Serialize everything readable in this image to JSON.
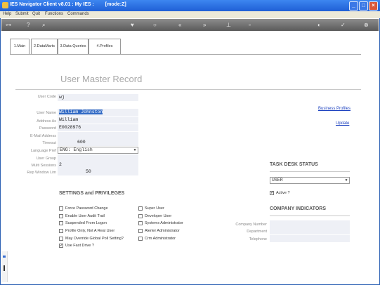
{
  "window": {
    "title": "IES Navigator Client v8.01 : My IES :",
    "mode": "[mode:Z]"
  },
  "menu": [
    "Help",
    "Submit",
    "Quit",
    "Functions",
    "Commands"
  ],
  "tabs": [
    "1.Main",
    "2.DataMarts",
    "3.Data Queries",
    "4.Profiles"
  ],
  "page_title": "User Master Record",
  "form": {
    "user_code": {
      "label": "User Code",
      "value": "wj"
    },
    "user_name": {
      "label": "User Name",
      "value": "William Johnston"
    },
    "address_as": {
      "label": "Address As",
      "value": "William"
    },
    "password": {
      "label": "Password",
      "value": "E0028976"
    },
    "email": {
      "label": "E-Mail Address",
      "value": ""
    },
    "timeout": {
      "label": "Timeout",
      "value": "600"
    },
    "language": {
      "label": "Language Pref",
      "value": "ENG: English"
    },
    "user_group": {
      "label": "User Group",
      "value": ""
    },
    "multi_sessions": {
      "label": "Multi Sessions",
      "value": "2"
    },
    "rep_window": {
      "label": "Rep Window Lim",
      "value": "50"
    }
  },
  "links": {
    "business_profiles": "Business Profiles",
    "update": "Update"
  },
  "settings": {
    "heading": "SETTINGS and PRIVILEGES",
    "left": [
      {
        "label": "Force Password Change",
        "checked": false
      },
      {
        "label": "Enable User Audit Trail",
        "checked": false
      },
      {
        "label": "Suspended From Logon",
        "checked": false
      },
      {
        "label": "Profile Only, Not A Real User",
        "checked": false
      },
      {
        "label": "May Override Global Poll Setting?",
        "checked": false
      },
      {
        "label": "Use Fast Drive ?",
        "checked": true
      }
    ],
    "right": [
      {
        "label": "Super User",
        "checked": false
      },
      {
        "label": "Developer User",
        "checked": false
      },
      {
        "label": "Systems Administrator",
        "checked": false
      },
      {
        "label": "Alerter Administrator",
        "checked": false
      },
      {
        "label": "Crm Administrator",
        "checked": false
      }
    ]
  },
  "task_desk": {
    "heading": "TASK DESK STATUS",
    "status_value": "USER",
    "active_label": "Active ?",
    "active_checked": true
  },
  "company": {
    "heading": "COMPANY INDICATORS",
    "fields": [
      {
        "label": "Company Number",
        "value": ""
      },
      {
        "label": "Department",
        "value": ""
      },
      {
        "label": "Telephone",
        "value": ""
      }
    ]
  }
}
